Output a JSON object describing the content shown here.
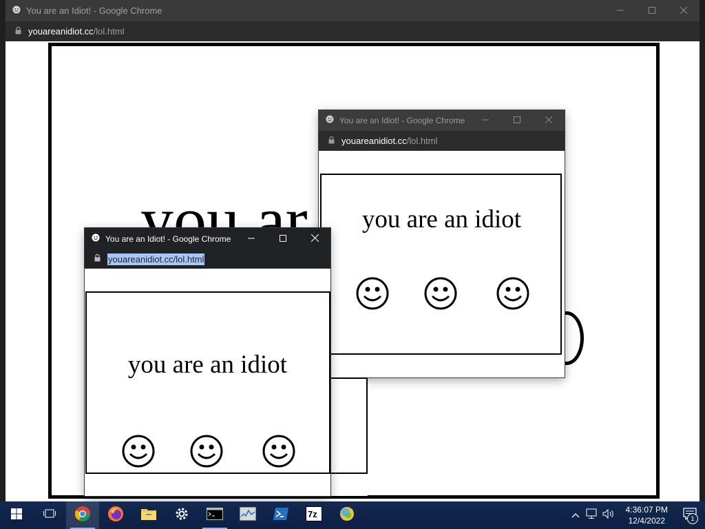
{
  "windows": {
    "main": {
      "title": "You are an Idiot! - Google Chrome",
      "url_host": "youareanidiot.cc",
      "url_path": "/lol.html"
    },
    "popup_right": {
      "title": "You are an Idiot! - Google Chrome",
      "url_host": "youareanidiot.cc",
      "url_path": "/lol.html",
      "message": "you are an idiot"
    },
    "popup_left": {
      "title": "You are an Idiot! - Google Chrome",
      "url_selected": "youareanidiot.cc/lol.html",
      "message": "you are an idiot"
    }
  },
  "background_page": {
    "large_text_visible": "you ar"
  },
  "icons": {
    "favicon": "smiley-icon",
    "minimize": "minimize-icon",
    "maximize": "maximize-icon",
    "close": "close-icon",
    "lock": "lock-icon"
  },
  "taskbar": {
    "apps": [
      "start-icon",
      "task-view-icon",
      "chrome-icon",
      "firefox-icon",
      "file-explorer-icon",
      "settings-icon",
      "terminal-icon",
      "task-manager-icon",
      "powershell-icon",
      "7zip-icon",
      "app-icon"
    ],
    "clock_time": "4:36:07 PM",
    "clock_date": "12/4/2022",
    "notification_count": "1"
  },
  "colors": {
    "taskbar_bg": "#13294f",
    "titlebar_active": "#202124",
    "titlebar_inactive": "#3c3c3c",
    "url_selection": "#a8c7fa"
  }
}
